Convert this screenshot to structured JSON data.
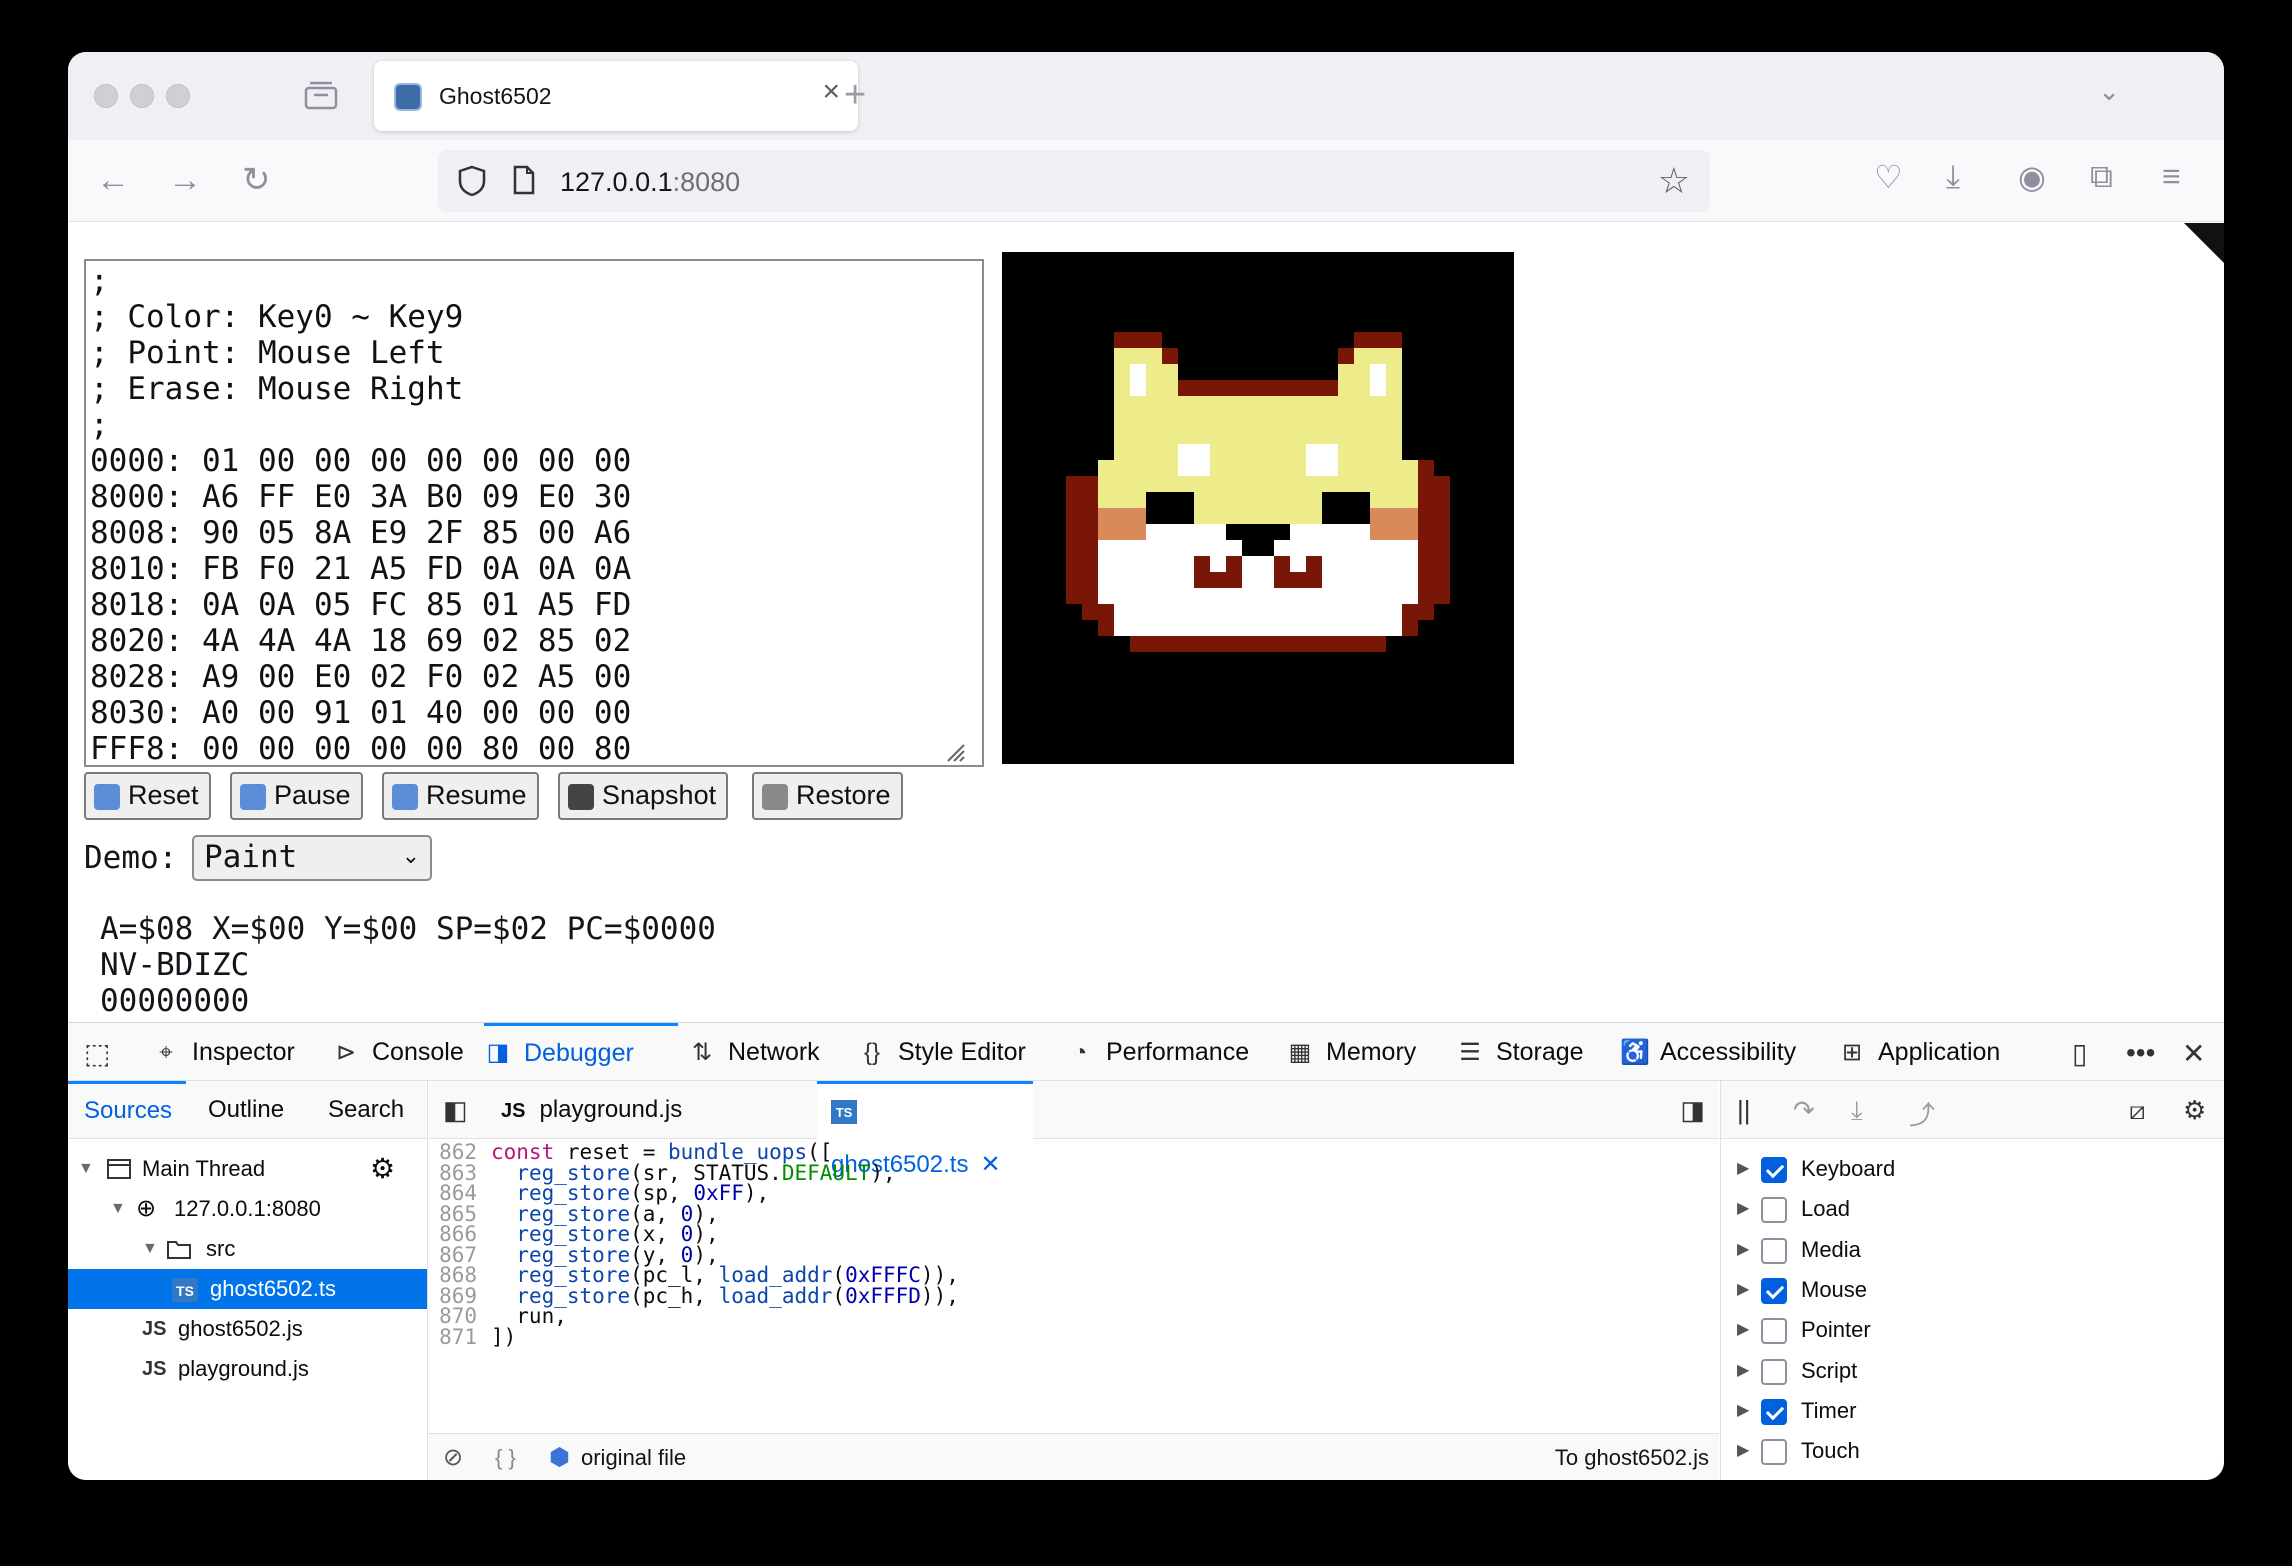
{
  "browser": {
    "tab_title": "Ghost6502",
    "url_host": "127.0.0.1",
    "url_port": ":8080"
  },
  "page": {
    "code_text": ";\n; Color: Key0 ~ Key9\n; Point: Mouse Left\n; Erase: Mouse Right\n;\n0000: 01 00 00 00 00 00 00 00\n8000: A6 FF E0 3A B0 09 E0 30\n8008: 90 05 8A E9 2F 85 00 A6\n8010: FB F0 21 A5 FD 0A 0A 0A\n8018: 0A 0A 05 FC 85 01 A5 FD\n8020: 4A 4A 4A 18 69 02 85 02\n8028: A9 00 E0 02 F0 02 A5 00\n8030: A0 00 91 01 40 00 00 00\nFFF8: 00 00 00 00 00 80 00 80",
    "buttons": {
      "reset": "Reset",
      "pause": "Pause",
      "resume": "Resume",
      "snapshot": "Snapshot",
      "restore": "Restore"
    },
    "demo_label": "Demo:",
    "demo_value": "Paint",
    "registers": "A=$08 X=$00 Y=$00 SP=$02 PC=$0000",
    "flags_label": "NV-BDIZC",
    "flags_value": "00000000"
  },
  "devtools": {
    "tabs": [
      "Inspector",
      "Console",
      "Debugger",
      "Network",
      "Style Editor",
      "Performance",
      "Memory",
      "Storage",
      "Accessibility",
      "Application"
    ],
    "active_tab": "Debugger",
    "source_tabs": [
      "Sources",
      "Outline",
      "Search"
    ],
    "tree": {
      "thread": "Main Thread",
      "host": "127.0.0.1:8080",
      "folder": "src",
      "selected_file": "ghost6502.ts",
      "file2": "ghost6502.js",
      "file3": "playground.js"
    },
    "editor_tabs": {
      "tab1": "playground.js",
      "tab2": "ghost6502.ts"
    },
    "code_lines": [
      {
        "n": "862",
        "t": "const reset = bundle_uops(["
      },
      {
        "n": "863",
        "t": "  reg_store(sr, STATUS.DEFAULT),"
      },
      {
        "n": "864",
        "t": "  reg_store(sp, 0xFF),"
      },
      {
        "n": "865",
        "t": "  reg_store(a, 0),"
      },
      {
        "n": "866",
        "t": "  reg_store(x, 0),"
      },
      {
        "n": "867",
        "t": "  reg_store(y, 0),"
      },
      {
        "n": "868",
        "t": "  reg_store(pc_l, load_addr(0xFFFC)),"
      },
      {
        "n": "869",
        "t": "  reg_store(pc_h, load_addr(0xFFFD)),"
      },
      {
        "n": "870",
        "t": "  run,"
      },
      {
        "n": "871",
        "t": "])"
      }
    ],
    "footer": {
      "original_file": "original file",
      "to_file": "To ghost6502.js"
    },
    "event_breakpoints": [
      {
        "label": "Keyboard",
        "checked": true
      },
      {
        "label": "Load",
        "checked": false
      },
      {
        "label": "Media",
        "checked": false
      },
      {
        "label": "Mouse",
        "checked": true
      },
      {
        "label": "Pointer",
        "checked": false
      },
      {
        "label": "Script",
        "checked": false
      },
      {
        "label": "Timer",
        "checked": true
      },
      {
        "label": "Touch",
        "checked": false
      }
    ]
  },
  "colors": {
    "accent": "#0060df",
    "selection": "#0074e8",
    "dog_yellow": "#eeec8a",
    "dog_outline": "#7a1607",
    "dog_cheek": "#d88a5a"
  }
}
